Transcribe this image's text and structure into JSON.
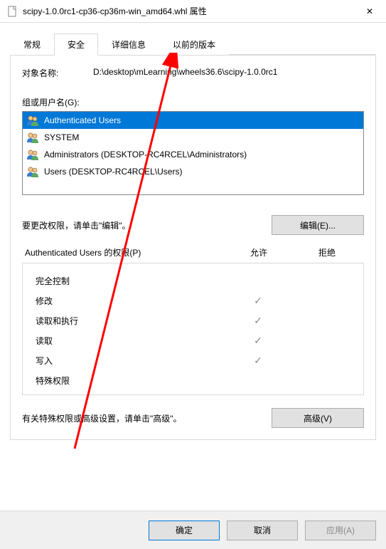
{
  "window": {
    "title": "scipy-1.0.0rc1-cp36-cp36m-win_amd64.whl 属性",
    "close_label": "✕"
  },
  "tabs": {
    "general": "常规",
    "security": "安全",
    "details": "详细信息",
    "previous": "以前的版本",
    "active_index": 1
  },
  "object": {
    "label": "对象名称:",
    "value": "D:\\desktop\\mLearning\\wheels36.6\\scipy-1.0.0rc1"
  },
  "groups": {
    "label": "组或用户名(G):",
    "items": [
      {
        "name": "Authenticated Users",
        "selected": true
      },
      {
        "name": "SYSTEM",
        "selected": false
      },
      {
        "name": "Administrators (DESKTOP-RC4RCEL\\Administrators)",
        "selected": false
      },
      {
        "name": "Users (DESKTOP-RC4RCEL\\Users)",
        "selected": false
      }
    ]
  },
  "edit": {
    "text": "要更改权限，请单击\"编辑\"。",
    "button": "编辑(E)..."
  },
  "permissions": {
    "header_name": "Authenticated Users 的权限(P)",
    "header_allow": "允许",
    "header_deny": "拒绝",
    "rows": [
      {
        "name": "完全控制",
        "allow": false,
        "deny": false
      },
      {
        "name": "修改",
        "allow": true,
        "deny": false
      },
      {
        "name": "读取和执行",
        "allow": true,
        "deny": false
      },
      {
        "name": "读取",
        "allow": true,
        "deny": false
      },
      {
        "name": "写入",
        "allow": true,
        "deny": false
      },
      {
        "name": "特殊权限",
        "allow": false,
        "deny": false
      }
    ]
  },
  "advanced": {
    "text": "有关特殊权限或高级设置，请单击\"高级\"。",
    "button": "高级(V)"
  },
  "footer": {
    "ok": "确定",
    "cancel": "取消",
    "apply": "应用(A)"
  },
  "annotation": {
    "arrow_color": "#ff0000"
  }
}
